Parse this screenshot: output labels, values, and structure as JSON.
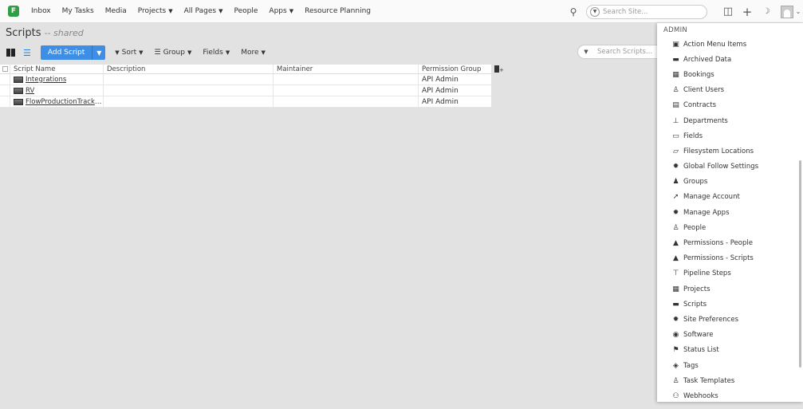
{
  "topnav": {
    "logo_letter": "F",
    "items": [
      {
        "label": "Inbox",
        "caret": false
      },
      {
        "label": "My Tasks",
        "caret": false
      },
      {
        "label": "Media",
        "caret": false
      },
      {
        "label": "Projects",
        "caret": true
      },
      {
        "label": "All Pages",
        "caret": true
      },
      {
        "label": "People",
        "caret": false
      },
      {
        "label": "Apps",
        "caret": true
      },
      {
        "label": "Resource Planning",
        "caret": false
      }
    ],
    "search_placeholder": "Search Site..."
  },
  "page": {
    "title": "Scripts",
    "subtitle": "-- shared"
  },
  "toolbar": {
    "add_label": "Add Script",
    "sort_label": "Sort",
    "group_label": "Group",
    "fields_label": "Fields",
    "more_label": "More",
    "search_placeholder": "Search Scripts..."
  },
  "grid": {
    "columns": [
      "Script Name",
      "Description",
      "Maintainer",
      "Permission Group"
    ],
    "rows": [
      {
        "name": "Integrations",
        "description": "",
        "maintainer": "",
        "permission": "API Admin"
      },
      {
        "name": "RV",
        "description": "",
        "maintainer": "",
        "permission": "API Admin"
      },
      {
        "name": "FlowProductionTracki...",
        "description": "",
        "maintainer": "",
        "permission": "API Admin"
      }
    ]
  },
  "admin_menu": {
    "header": "ADMIN",
    "items": [
      {
        "label": "Action Menu Items",
        "icon": "action-menu-icon",
        "glyph": "▣"
      },
      {
        "label": "Archived Data",
        "icon": "archive-icon",
        "glyph": "▬"
      },
      {
        "label": "Bookings",
        "icon": "calendar-icon",
        "glyph": "▦"
      },
      {
        "label": "Client Users",
        "icon": "client-user-icon",
        "glyph": "♙"
      },
      {
        "label": "Contracts",
        "icon": "contract-icon",
        "glyph": "▤"
      },
      {
        "label": "Departments",
        "icon": "org-chart-icon",
        "glyph": "⊥"
      },
      {
        "label": "Fields",
        "icon": "fields-icon",
        "glyph": "▭"
      },
      {
        "label": "Filesystem Locations",
        "icon": "folder-icon",
        "glyph": "▱"
      },
      {
        "label": "Global Follow Settings",
        "icon": "gear-icon",
        "glyph": "✹"
      },
      {
        "label": "Groups",
        "icon": "group-icon",
        "glyph": "♟"
      },
      {
        "label": "Manage Account",
        "icon": "account-icon",
        "glyph": "➚"
      },
      {
        "label": "Manage Apps",
        "icon": "gear-icon",
        "glyph": "✹"
      },
      {
        "label": "People",
        "icon": "person-icon",
        "glyph": "♙"
      },
      {
        "label": "Permissions - People",
        "icon": "lock-icon",
        "glyph": "▲"
      },
      {
        "label": "Permissions - Scripts",
        "icon": "lock-icon",
        "glyph": "▲"
      },
      {
        "label": "Pipeline Steps",
        "icon": "pipeline-icon",
        "glyph": "⊤"
      },
      {
        "label": "Projects",
        "icon": "project-icon",
        "glyph": "▦"
      },
      {
        "label": "Scripts",
        "icon": "script-icon",
        "glyph": "▬"
      },
      {
        "label": "Site Preferences",
        "icon": "gear-icon",
        "glyph": "✹"
      },
      {
        "label": "Software",
        "icon": "software-icon",
        "glyph": "◉"
      },
      {
        "label": "Status List",
        "icon": "flag-icon",
        "glyph": "⚑"
      },
      {
        "label": "Tags",
        "icon": "tag-icon",
        "glyph": "◈"
      },
      {
        "label": "Task Templates",
        "icon": "task-template-icon",
        "glyph": "♙"
      },
      {
        "label": "Webhooks",
        "icon": "webhook-icon",
        "glyph": "⚇"
      }
    ]
  }
}
